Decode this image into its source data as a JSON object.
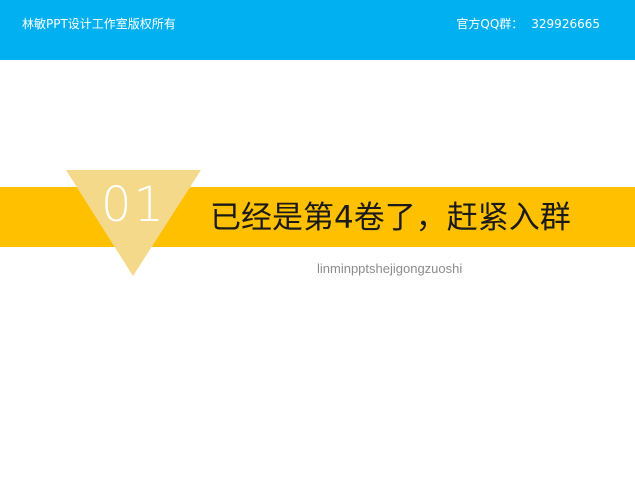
{
  "header": {
    "copyright": "林敏PPT设计工作室版权所有",
    "qq_label": "官方QQ群：",
    "qq_number": "329926665"
  },
  "section": {
    "number": "01",
    "title": "已经是第4卷了，赶紧入群",
    "subtitle": "linminpptshejigongzuoshi"
  },
  "colors": {
    "top_bar": "#00b0f0",
    "band": "#ffc000",
    "triangle": "#f5d98a",
    "title_text": "#1a1a1a",
    "subtitle_text": "#8c8c8c"
  }
}
